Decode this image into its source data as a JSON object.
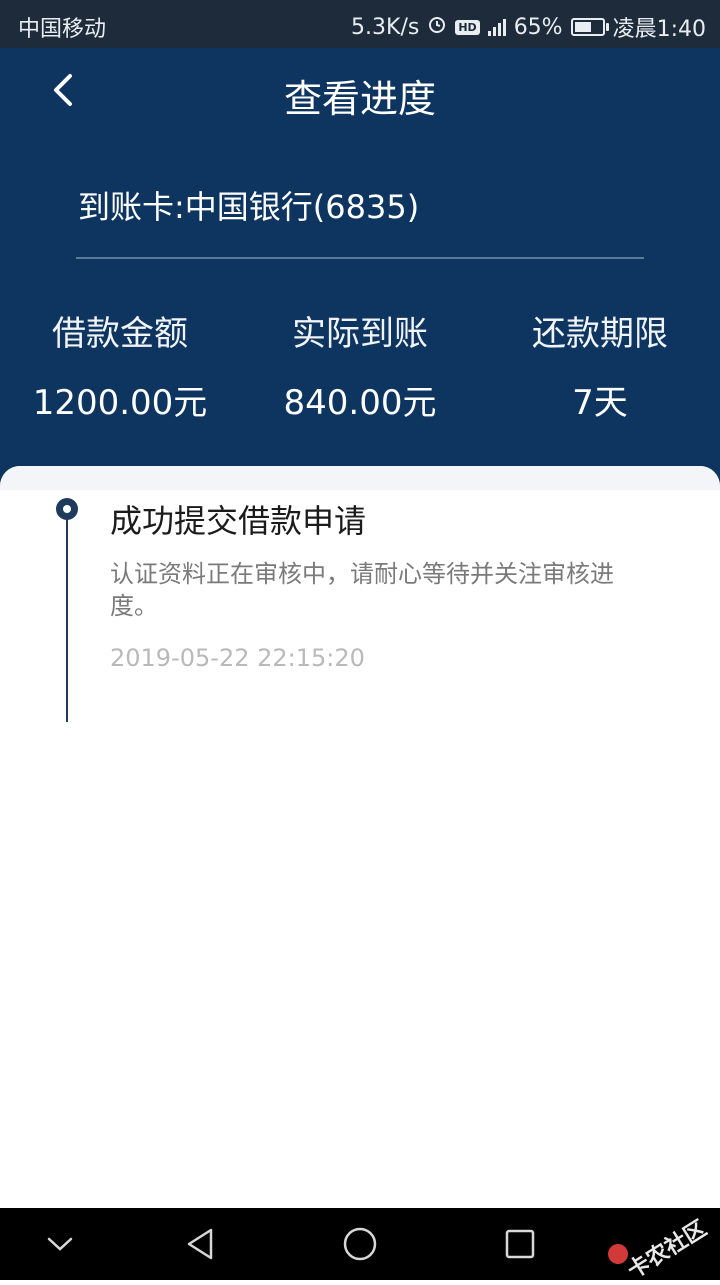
{
  "status_bar": {
    "carrier": "中国移动",
    "net_speed": "5.3K/s",
    "hd": "HD",
    "battery_percent": "65%",
    "battery_level": 0.65,
    "time": "凌晨1:40",
    "icons": [
      "alarm-icon",
      "hd-icon",
      "signal-4g-icon",
      "battery-icon"
    ]
  },
  "header": {
    "title": "查看进度",
    "card_label": "到账卡:中国银行(6835)",
    "stats": [
      {
        "label": "借款金额",
        "value": "1200.00元"
      },
      {
        "label": "实际到账",
        "value": "840.00元"
      },
      {
        "label": "还款期限",
        "value": "7天"
      }
    ]
  },
  "timeline": {
    "events": [
      {
        "title": "成功提交借款申请",
        "description": "认证资料正在审核中，请耐心等待并关注审核进度。",
        "time": "2019-05-22 22:15:20"
      }
    ]
  },
  "nav_bar": {
    "icons": [
      "chevron-down-icon",
      "back-triangle-icon",
      "home-circle-icon",
      "recents-square-icon"
    ],
    "watermark": "卡农社区"
  },
  "colors": {
    "header_bg": "#0e3560",
    "status_bg": "#1e2b3a",
    "timeline": "#1f3a5c"
  }
}
